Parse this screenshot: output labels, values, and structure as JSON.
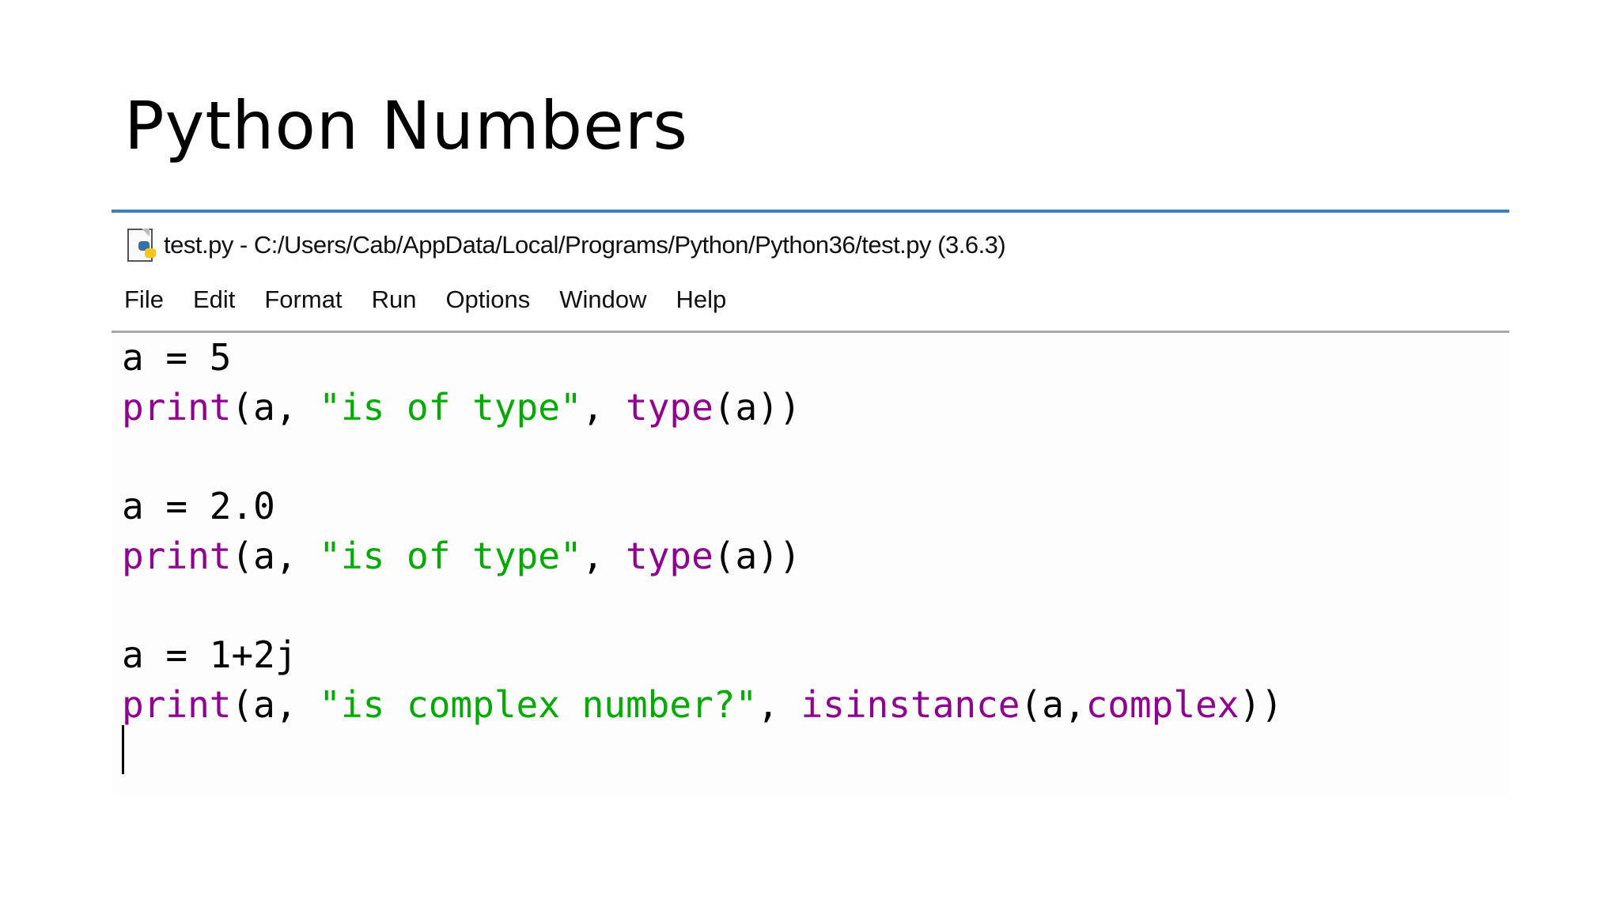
{
  "slide": {
    "title": "Python Numbers"
  },
  "window": {
    "title": "test.py - C:/Users/Cab/AppData/Local/Programs/Python/Python36/test.py (3.6.3)",
    "icon": "python-file-icon"
  },
  "menu": {
    "items": [
      "File",
      "Edit",
      "Format",
      "Run",
      "Options",
      "Window",
      "Help"
    ]
  },
  "editor": {
    "lines": [
      {
        "segments": [
          {
            "text": "a = 5",
            "style": "plain"
          }
        ]
      },
      {
        "segments": [
          {
            "text": "print",
            "style": "builtin"
          },
          {
            "text": "(a, ",
            "style": "plain"
          },
          {
            "text": "\"is of type\"",
            "style": "string"
          },
          {
            "text": ", ",
            "style": "plain"
          },
          {
            "text": "type",
            "style": "builtin"
          },
          {
            "text": "(a))",
            "style": "plain"
          }
        ]
      },
      {
        "segments": [
          {
            "text": "a = 2.0",
            "style": "plain"
          }
        ]
      },
      {
        "segments": [
          {
            "text": "print",
            "style": "builtin"
          },
          {
            "text": "(a, ",
            "style": "plain"
          },
          {
            "text": "\"is of type\"",
            "style": "string"
          },
          {
            "text": ", ",
            "style": "plain"
          },
          {
            "text": "type",
            "style": "builtin"
          },
          {
            "text": "(a))",
            "style": "plain"
          }
        ]
      },
      {
        "segments": [
          {
            "text": "a = 1+2j",
            "style": "plain"
          }
        ]
      },
      {
        "segments": [
          {
            "text": "print",
            "style": "builtin"
          },
          {
            "text": "(a, ",
            "style": "plain"
          },
          {
            "text": "\"is complex number?\"",
            "style": "string"
          },
          {
            "text": ", ",
            "style": "plain"
          },
          {
            "text": "isinstance",
            "style": "builtin"
          },
          {
            "text": "(a,",
            "style": "plain"
          },
          {
            "text": "complex",
            "style": "builtin"
          },
          {
            "text": "))",
            "style": "plain"
          }
        ]
      }
    ]
  },
  "colors": {
    "accent_border": "#3f7fc1",
    "builtin": "#900090",
    "string": "#00aa00",
    "plain": "#000000"
  }
}
